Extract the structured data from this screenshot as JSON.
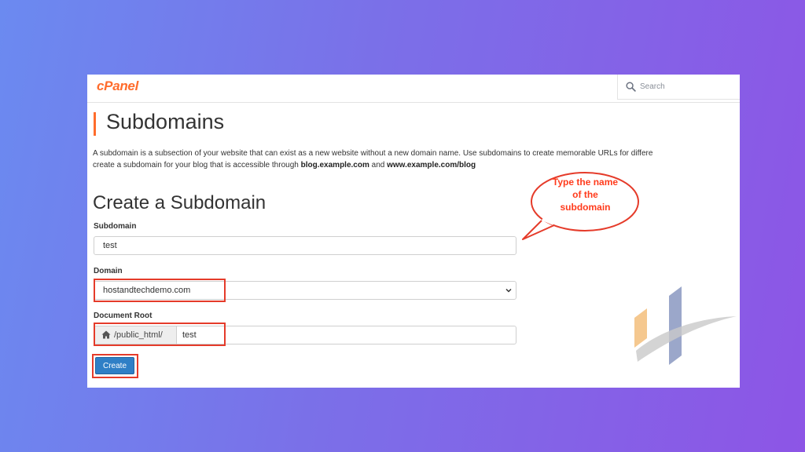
{
  "header": {
    "logo_text": "cPanel",
    "search_placeholder": "Search"
  },
  "page": {
    "title": "Subdomains",
    "description_line1": "A subdomain is a subsection of your website that can exist as a new website without a new domain name. Use subdomains to create memorable URLs for differe",
    "description_line2_prefix": "create a subdomain for your blog that is accessible through ",
    "description_example1": "blog.example.com",
    "description_and": " and ",
    "description_example2": "www.example.com/blog"
  },
  "form": {
    "section_title": "Create a Subdomain",
    "subdomain_label": "Subdomain",
    "subdomain_value": "test",
    "domain_label": "Domain",
    "domain_value": "hostandtechdemo.com",
    "docroot_label": "Document Root",
    "docroot_prefix": "/public_html/",
    "docroot_value": "test",
    "create_label": "Create"
  },
  "annotation": {
    "callout_line1": "Type the name",
    "callout_line2": "of the",
    "callout_line3": "subdomain"
  },
  "colors": {
    "accent": "#ff6c2c",
    "highlight": "#e53b2a",
    "button": "#2f7fc6"
  }
}
